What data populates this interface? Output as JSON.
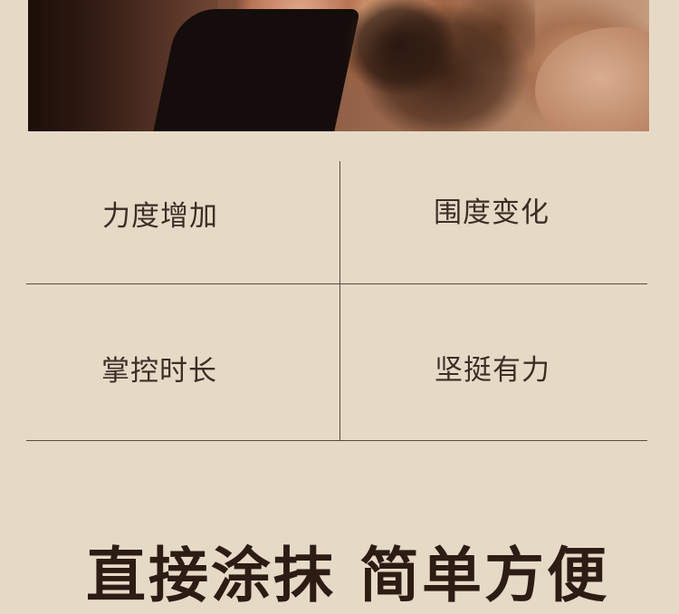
{
  "features": [
    {
      "label": "力度增加"
    },
    {
      "label": "围度变化"
    },
    {
      "label": "掌控时长"
    },
    {
      "label": "坚挺有力"
    }
  ],
  "slogan": "直接涂抹 简单方便",
  "colors": {
    "background": "#e6dac7",
    "grid_line": "#594a3f",
    "label_text": "#3b2e26",
    "slogan_text": "#2c1c14"
  }
}
